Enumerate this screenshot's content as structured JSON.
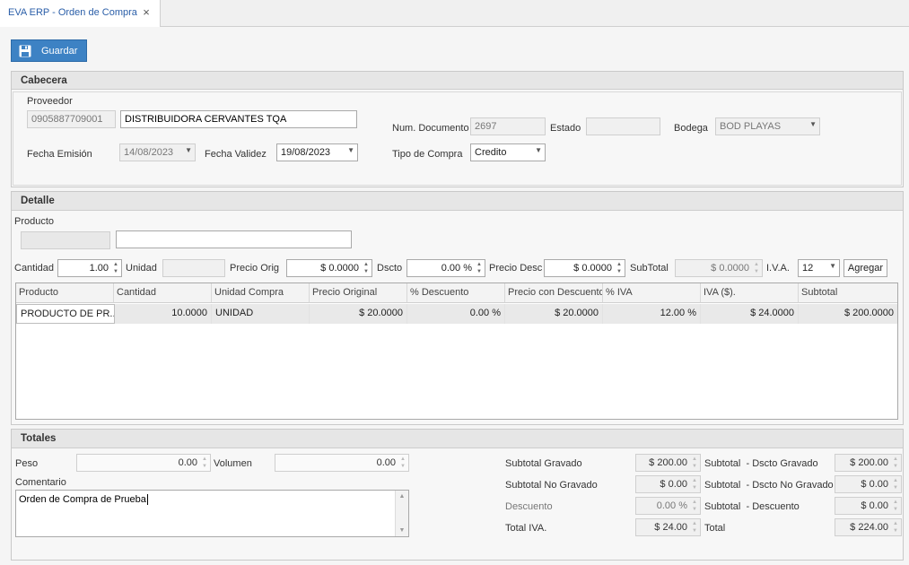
{
  "tab": {
    "title": "EVA ERP - Orden de Compra",
    "close": "×"
  },
  "toolbar": {
    "save_label": "Guardar"
  },
  "cabecera": {
    "title": "Cabecera",
    "proveedor_label": "Proveedor",
    "proveedor_id": "0905887709001",
    "proveedor_name": "DISTRIBUIDORA CERVANTES TQA",
    "fecha_emision_label": "Fecha Emisión",
    "fecha_emision": "14/08/2023",
    "fecha_validez_label": "Fecha Validez",
    "fecha_validez": "19/08/2023",
    "num_documento_label": "Num. Documento",
    "num_documento": "2697",
    "estado_label": "Estado",
    "estado": "",
    "bodega_label": "Bodega",
    "bodega": "BOD PLAYAS",
    "tipo_compra_label": "Tipo de Compra",
    "tipo_compra": "Credito"
  },
  "detalle": {
    "title": "Detalle",
    "producto_label": "Producto",
    "producto_code": "",
    "producto_name": "",
    "cantidad_label": "Cantidad",
    "cantidad": "1.00",
    "unidad_label": "Unidad",
    "unidad": "",
    "precio_orig_label": "Precio Orig",
    "precio_orig": "$ 0.0000",
    "dscto_label": "Dscto",
    "dscto": "0.00 %",
    "precio_desc_label": "Precio Desc",
    "precio_desc": "$ 0.0000",
    "subtotal_label": "SubTotal",
    "subtotal": "$ 0.0000",
    "iva_label": "I.V.A.",
    "iva": "12",
    "agregar_label": "Agregar",
    "grid": {
      "headers": [
        "Producto",
        "Cantidad",
        "Unidad Compra",
        "Precio Original",
        "% Descuento",
        "Precio con Descuento",
        "% IVA",
        "IVA ($).",
        "Subtotal"
      ],
      "rows": [
        [
          "PRODUCTO DE PR...",
          "10.0000",
          "UNIDAD",
          "$ 20.0000",
          "0.00 %",
          "$ 20.0000",
          "12.00 %",
          "$ 24.0000",
          "$ 200.0000"
        ]
      ]
    }
  },
  "totales": {
    "title": "Totales",
    "peso_label": "Peso",
    "peso": "0.00",
    "volumen_label": "Volumen",
    "volumen": "0.00",
    "comentario_label": "Comentario",
    "comentario": "Orden de Compra de Prueba",
    "subtotal_gravado_label": "Subtotal Gravado",
    "subtotal_gravado": "$ 200.00",
    "subtotal_no_gravado_label": "Subtotal No Gravado",
    "subtotal_no_gravado": "$ 0.00",
    "descuento_label": "Descuento",
    "descuento": "0.00 %",
    "total_iva_label": "Total IVA.",
    "total_iva": "$ 24.00",
    "dscto_gravado_label": "Subtotal  - Dscto Gravado",
    "dscto_gravado": "$ 200.00",
    "dscto_no_gravado_label": "Subtotal  - Dscto No Gravado",
    "dscto_no_gravado": "$ 0.00",
    "subtotal_descuento_label": "Subtotal  - Descuento",
    "subtotal_descuento": "$ 0.00",
    "total_label": "Total",
    "total": "$ 224.00"
  }
}
